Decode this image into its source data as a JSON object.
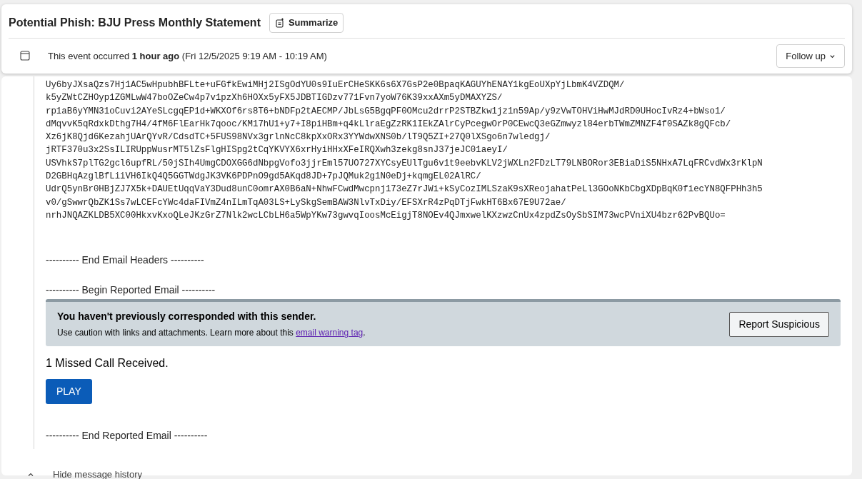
{
  "header": {
    "title": "Potential Phish: BJU Press Monthly Statement",
    "summarize_button": "Summarize",
    "event_text": "This event occurred **1 hour ago** (Fri 12/5/2025 9:19 AM - 10:19 AM)",
    "follow_up_button": "Follow up"
  },
  "body": {
    "header_lines": [
      "Uy6byJXsaQzs7Hj1AC5wHpubhBFLte+uFGfkEwiMHj2ISgOdYU0s9IuErCHeSKK6s6X7GsP2e0BpaqKAGUYhENAY1kgEoUXpYjLbmK4VZDQM/",
      "k5yZWtCZHOyp1ZGMLwW47boOZeCw4p7v1pzXh6HOXx5yFX5JDBTIGDzv771Fvn7yoW76K39xxAXm5yDMAXYZS/",
      "rp1aB6yYMN31oCuvi2AYeSLcgqEP1d+WKXOf6rs8T6+bNDFp2tAECMP/JbLsG5BgqPF0OMcu2drrP2STBZkw1jz1n59Ap/y9zVwTOHViHwMJdRD0UHocIvRz4+bWso1/",
      "dMqvvK5qRdxkDthg7H4/4fM6FlEarHk7qooc/KM17hU1+y7+I8piHBm+q4kLlraEgZzRK1IEkZAlrCyPcegwOrP0CEwcQ3eGZmwyzl84erbTWmZMNZF4f0SAZk8gQFcb/",
      "Xz6jK8Qjd6KezahjUArQYvR/CdsdTC+5FUS98NVx3grlnNcC8kpXxORx3YYWdwXNS0b/lT9Q5ZI+27Q0lXSgo6n7wledgj/",
      "jRTF370u3x2SsILIRUppWusrMT5lZsFlgHISpg2tCqYKVYX6xrHyiHHxXFeIRQXwh3zekg8snJ37jeJC01aeyI/",
      "USVhkS7plTG2gcl6upfRL/50jSIh4UmgCDOXGG6dNbpgVofo3jjrEml57UO727XYCsyEUlTgu6v1t9eebvKLV2jWXLn2FDzLT79LNBORor3EBiaDiS5NHxA7LqFRCvdWx3rKlpN",
      "D2GBHqAzglBfLiiVH6IkQ4Q5GGTWdgJK3VK6PDPnO9gd5AKqd8JD+7pJQMuk2g1N0eDj+kqmgEL02AlRC/",
      "UdrQ5ynBr0HBjZJ7X5k+DAUEtUqqVaY3Dud8unC0omrAX0B6aN+NhwFCwdMwcpnj173eZ7rJWi+kSyCozIMLSzaK9sXReojahatPeLl3GOoNKbCbgXDpBqK0fiecYN8QFPHh3h5",
      "v0/gSwwrQbZK1Ss7wLCEFcYWc4daFIVmZ4nILmTqA03LS+LySkgSemBAW3NlvTxDiy/EFSXrR4zPqDTjFwkHT6Bx67E9U72ae/",
      "nrhJNQAZKLDB5XC00HkxvKxoQLeJKzGrZ7Nlk2wcLCbLH6a5WpYKw73gwvqIoosMcEigjT8NOEv4QJmxwelKXzwzCnUx4zpdZsOySbSIM73wcPVniXU4bzr62PvBQUo="
    ],
    "end_headers": "---------- End Email Headers ----------",
    "begin_reported": "---------- Begin Reported Email ----------",
    "warning": {
      "title": "You haven't previously corresponded with this sender.",
      "text": "Use caution with links and attachments. Learn more about this ",
      "link": "email warning tag",
      "text_end": ".",
      "button": "Report Suspicious"
    },
    "message": "1 Missed Call Received.",
    "play_button": "PLAY",
    "end_reported": "---------- End Reported Email ----------"
  },
  "footer": {
    "toggle": "Hide message history"
  }
}
